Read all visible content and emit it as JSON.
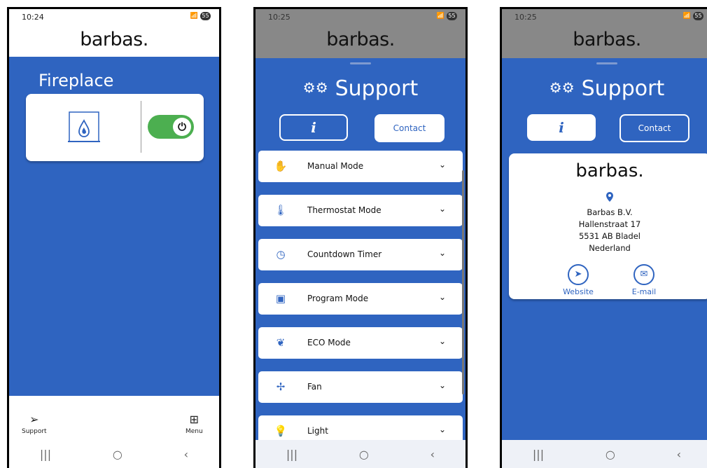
{
  "brand_name": "barbas.",
  "screen1": {
    "status_time": "10:24",
    "status_battery": "55",
    "page_title": "Fireplace",
    "power_icon": "⏻",
    "bottom_nav": {
      "support_label": "Support",
      "menu_label": "Menu"
    }
  },
  "screen2": {
    "status_time": "10:25",
    "status_battery": "55",
    "title": "Support",
    "info_label": "i",
    "contact_label": "Contact",
    "sections": [
      {
        "icon": "hand-icon",
        "label": "Manual Mode"
      },
      {
        "icon": "thermometer-icon",
        "label": "Thermostat Mode"
      },
      {
        "icon": "clock-icon",
        "label": "Countdown Timer"
      },
      {
        "icon": "program-icon",
        "label": "Program Mode"
      },
      {
        "icon": "leaf-icon",
        "label": "ECO Mode"
      },
      {
        "icon": "fan-icon",
        "label": "Fan"
      },
      {
        "icon": "lightbulb-icon",
        "label": "Light"
      }
    ]
  },
  "screen3": {
    "status_time": "10:25",
    "status_battery": "55",
    "title": "Support",
    "info_label": "i",
    "contact_label": "Contact",
    "company": {
      "name": "Barbas B.V.",
      "street": "Hallenstraat 17",
      "city": "5531 AB Bladel",
      "country": "Nederland"
    },
    "website_label": "Website",
    "email_label": "E-mail"
  },
  "colors": {
    "primary_blue": "#2f64c0",
    "toggle_green": "#4caf50"
  }
}
